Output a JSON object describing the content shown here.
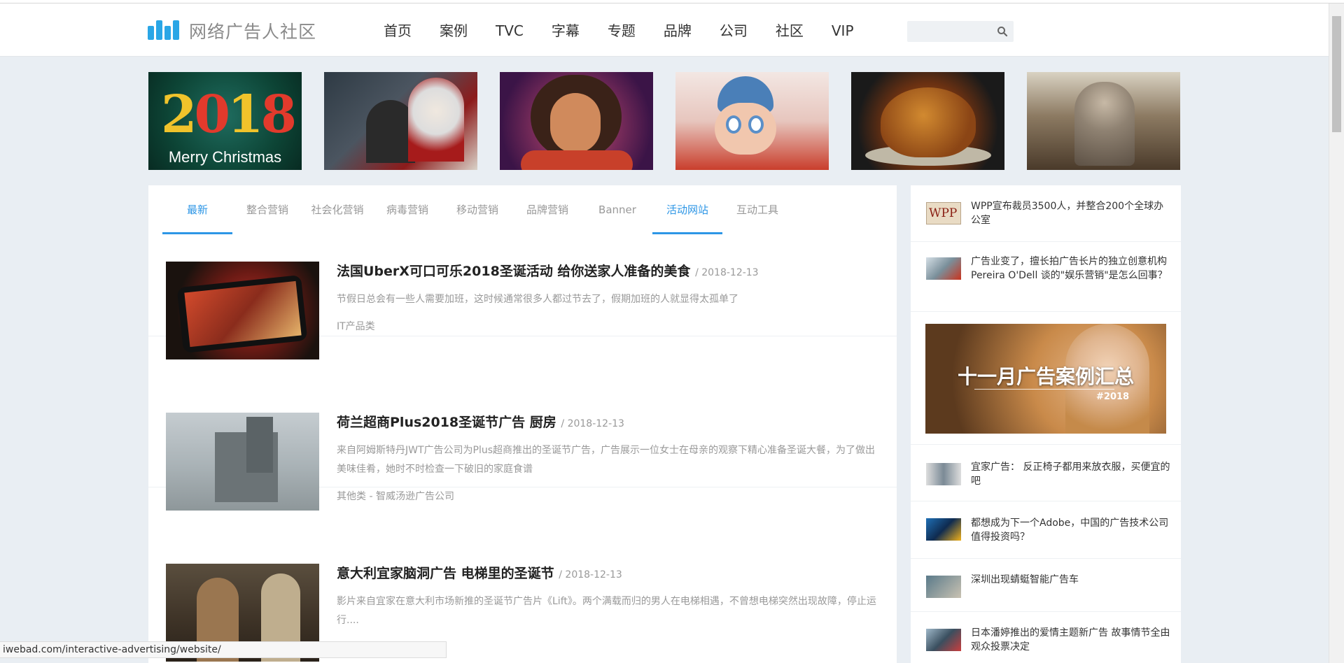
{
  "header": {
    "logo_text": "网络广告人社区",
    "nav": [
      "首页",
      "案例",
      "TVC",
      "字幕",
      "专题",
      "品牌",
      "公司",
      "社区",
      "VIP"
    ],
    "search_placeholder": ""
  },
  "banners": {
    "first_top": "2018",
    "first_caption": "Merry Christmas"
  },
  "tabs": [
    "最新",
    "整合营销",
    "社会化营销",
    "病毒营销",
    "移动营销",
    "品牌营销",
    "Banner",
    "活动网站",
    "互动工具"
  ],
  "articles": [
    {
      "title": "法国UberX可口可乐2018圣诞活动 给你送家人准备的美食",
      "date": "/ 2018-12-13",
      "desc": "节假日总会有一些人需要加班，这时候通常很多人都过节去了，假期加班的人就显得太孤单了",
      "category": "IT产品类"
    },
    {
      "title": "荷兰超商Plus2018圣诞节广告 厨房",
      "date": "/ 2018-12-13",
      "desc": "来自阿姆斯特丹JWT广告公司为Plus超商推出的圣诞节广告，广告展示一位女士在母亲的观察下精心准备圣诞大餐，为了做出美味佳肴，她时不时检查一下破旧的家庭食谱",
      "category": "其他类  - 智威汤逊广告公司"
    },
    {
      "title": "意大利宜家脑洞广告 电梯里的圣诞节",
      "date": "/ 2018-12-13",
      "desc": "影片来自宜家在意大利市场新推的圣诞节广告片《Lift》。两个满载而归的男人在电梯相遇，不曾想电梯突然出现故障，停止运行....",
      "category": ""
    }
  ],
  "sidebar": {
    "items": [
      "WPP宣布裁员3500人，并整合200个全球办公室",
      "广告业变了，擅长拍广告长片的独立创意机构 Pereira O'Dell 谈的\"娱乐营销\"是怎么回事？",
      "宜家广告： 反正椅子都用来放衣服，买便宜的吧",
      "都想成为下一个Adobe，中国的广告技术公司值得投资吗？",
      "深圳出现蜻蜓智能广告车",
      "日本潘婷推出的爱情主题新广告 故事情节全由观众投票决定"
    ],
    "feature_title": "十一月广告案例汇总",
    "feature_tag": "#2018"
  },
  "status_url": "iwebad.com/interactive-advertising/website/",
  "colors": {
    "accent": "#2d96e6",
    "logo": "#2aa6e6",
    "bg": "#e9eef3"
  }
}
